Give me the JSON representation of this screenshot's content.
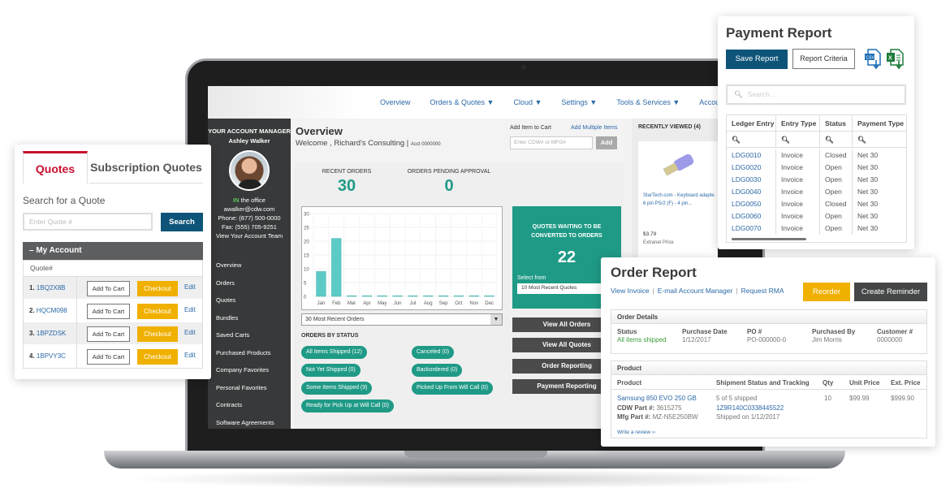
{
  "topnav": {
    "items": [
      "Overview",
      "Orders & Quotes ▼",
      "Cloud ▼",
      "Settings ▼",
      "Tools & Services ▼",
      "Account Te"
    ]
  },
  "account_manager": {
    "title": "YOUR ACCOUNT MANAGER",
    "name": "Ashley Walker",
    "status_in": "IN",
    "status_rest": " the office",
    "email": "awalker@cdw.com",
    "phone": "Phone: (877) 500-0000",
    "fax": "Fax: (555) 705-9251",
    "team_link": "View Your Account Team"
  },
  "side_menu": [
    "Overview",
    "Orders",
    "Quotes",
    "Bundles",
    "Saved Carts",
    "Purchased Products",
    "Company Favorites",
    "Personal Favorites",
    "Contracts",
    "Software Agreements"
  ],
  "overview": {
    "title": "Overview",
    "welcome": "Welcome , Richard's Consulting",
    "acct": "Acct 0000000",
    "add_item_label": "Add Item to Cart",
    "add_multiple": "Add Multiple Items",
    "cart_placeholder": "Enter CDW# or MFG#",
    "add_button": "Add",
    "recent_orders_label": "RECENT ORDERS",
    "recent_orders_value": "30",
    "pending_label": "ORDERS PENDING APPROVAL",
    "pending_value": "0",
    "orders_select": "30 Most Recent Orders",
    "orders_by_status_title": "ORDERS BY STATUS",
    "status_pills": [
      "All Items Shipped (12)",
      "Not Yet Shipped (0)",
      "Some Items Shipped (9)",
      "Ready for Pick Up at Will Call (0)",
      "Canceled (0)",
      "Backordered (0)",
      "Picked Up From Will Call (0)"
    ],
    "quotes_box": {
      "title_line1": "QUOTES WAITING TO BE",
      "title_line2": "CONVERTED TO ORDERS",
      "value": "22",
      "select_label": "Select from",
      "select_value": "10 Most Recent Quotes"
    },
    "action_buttons": [
      "View All Orders",
      "View All Quotes",
      "Order Reporting",
      "Payment Reporting"
    ]
  },
  "chart_data": {
    "type": "bar",
    "categories": [
      "Jan",
      "Feb",
      "Mar",
      "Apr",
      "May",
      "Jun",
      "Jul",
      "Aug",
      "Sep",
      "Oct",
      "Nov",
      "Dec"
    ],
    "values": [
      9,
      21,
      0,
      0,
      0,
      0,
      0,
      0,
      0,
      0,
      0,
      0
    ],
    "yticks": [
      0,
      5,
      10,
      15,
      20,
      25,
      30
    ],
    "ylim": [
      0,
      30
    ],
    "title": "",
    "xlabel": "",
    "ylabel": "",
    "grid": true,
    "bar_color": "#5ccbc6"
  },
  "recently_viewed": {
    "title": "RECENTLY VIEWED (4)",
    "item_line1": "StarTech.com - Keyboard adapte",
    "item_line2": "6 pin PS/2 (F) - 4 pin...",
    "price": "$3.79",
    "price_label": "Extranet Price"
  },
  "quotes_card": {
    "tab_active": "Quotes",
    "tab_other": "Subscription Quotes",
    "search_label": "Search for a Quote",
    "search_placeholder": "Enter Quote #",
    "search_button": "Search",
    "section": "– My Account",
    "column": "Quote#",
    "add_to_cart": "Add To Cart",
    "checkout": "Checkout",
    "edit": "Edit",
    "rows": [
      {
        "num": "1.",
        "id": "1BQ2X8B"
      },
      {
        "num": "2.",
        "id": "HQCM098"
      },
      {
        "num": "3.",
        "id": "1BPZDSK"
      },
      {
        "num": "4.",
        "id": "1BPVY3C"
      }
    ]
  },
  "payment_report": {
    "title": "Payment Report",
    "save_button": "Save Report",
    "criteria_button": "Report Criteria",
    "csv_icon": "csv-download",
    "xls_icon": "excel-download",
    "search_placeholder": "Search...",
    "columns": [
      "Ledger Entry",
      "Entry Type",
      "Status",
      "Payment Type"
    ],
    "rows": [
      [
        "LDG0010",
        "Invoice",
        "Closed",
        "Net 30"
      ],
      [
        "LDG0020",
        "Invoice",
        "Open",
        "Net 30"
      ],
      [
        "LDG0030",
        "Invoice",
        "Open",
        "Net 30"
      ],
      [
        "LDG0040",
        "Invoice",
        "Open",
        "Net 30"
      ],
      [
        "LDG0050",
        "Invoice",
        "Closed",
        "Net 30"
      ],
      [
        "LDG0060",
        "Invoice",
        "Open",
        "Net 30"
      ],
      [
        "LDG0070",
        "Invoice",
        "Open",
        "Net 30"
      ]
    ]
  },
  "order_report": {
    "title": "Order Report",
    "links": [
      "View Invoice",
      "E-mail Account Manager",
      "Request RMA"
    ],
    "reorder": "Reorder",
    "create_reminder": "Create Reminder",
    "details_title": "Order Details",
    "details": [
      {
        "label": "Status",
        "value": "All items shipped"
      },
      {
        "label": "Purchase Date",
        "value": "1/12/2017"
      },
      {
        "label": "PO #",
        "value": "PO-000000-0"
      },
      {
        "label": "Purchased By",
        "value": "Jim Morris"
      },
      {
        "label": "Customer #",
        "value": "0000000"
      }
    ],
    "product_title": "Product",
    "product_columns": [
      "Product",
      "Shipment Status and Tracking",
      "Qty",
      "Unit Price",
      "Ext. Price"
    ],
    "product": {
      "name": "Samsung 850 EVO 250 GB",
      "cdw_label": "CDW Part #:",
      "cdw_part": " 3615275",
      "mfg_label": "Mfg Part #:",
      "mfg_part": " MZ-N5E250BW",
      "shipped": "5 of 5 shipped",
      "tracking": "1Z9R140C0338445522",
      "shipped_on": "Shipped on 1/12/2017",
      "qty": "10",
      "unit_price": "$99.99",
      "ext_price": "$999.90",
      "review": "Write a review ››"
    }
  }
}
